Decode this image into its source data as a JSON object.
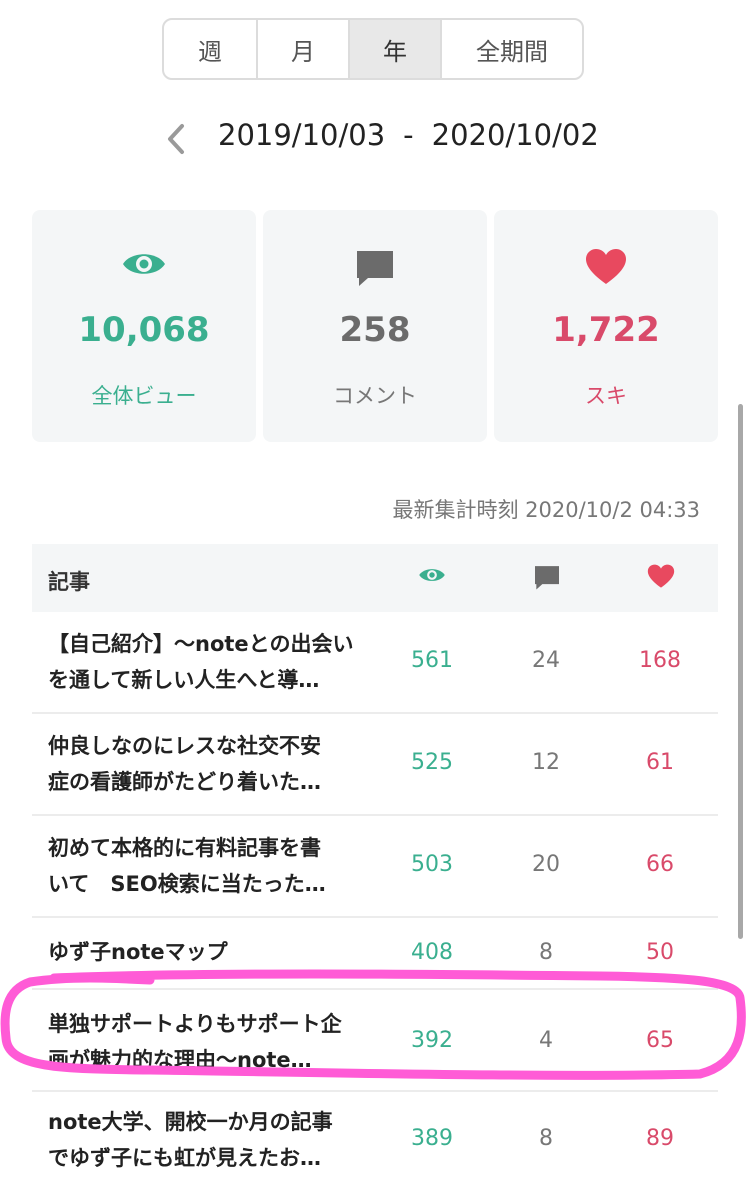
{
  "period_tabs": [
    "週",
    "月",
    "年",
    "全期間"
  ],
  "active_tab": "年",
  "date_range": {
    "start": "2019/10/03",
    "separator": "-",
    "end": "2020/10/02"
  },
  "stats": {
    "views": {
      "value": "10,068",
      "label": "全体ビュー",
      "color": "#3aaf8f",
      "icon": "eye-icon"
    },
    "comments": {
      "value": "258",
      "label": "コメント",
      "color": "#6b6b6b",
      "icon": "comment-icon"
    },
    "likes": {
      "value": "1,722",
      "label": "スキ",
      "color": "#d94a6a",
      "icon": "heart-icon"
    }
  },
  "updated_at": "最新集計時刻 2020/10/2 04:33",
  "table": {
    "header_article": "記事",
    "rows": [
      {
        "title_line1": "【自己紹介】〜noteとの出会い",
        "title_line2": "を通して新しい人生へと導…",
        "views": "561",
        "comments": "24",
        "likes": "168"
      },
      {
        "title_line1": "仲良しなのにレスな社交不安",
        "title_line2": "症の看護師がたどり着いた…",
        "views": "525",
        "comments": "12",
        "likes": "61"
      },
      {
        "title_line1": "初めて本格的に有料記事を書",
        "title_line2": "いて　SEO検索に当たった…",
        "views": "503",
        "comments": "20",
        "likes": "66"
      },
      {
        "title_line1": "ゆず子noteマップ",
        "title_line2": "",
        "views": "408",
        "comments": "8",
        "likes": "50"
      },
      {
        "title_line1": "単独サポートよりもサポート企",
        "title_line2": "画が魅力的な理由〜note…",
        "views": "392",
        "comments": "4",
        "likes": "65"
      },
      {
        "title_line1": "note大学、開校一か月の記事",
        "title_line2": "でゆず子にも虹が見えたお…",
        "views": "389",
        "comments": "8",
        "likes": "89"
      }
    ]
  },
  "highlight_color": "#ff5bd6"
}
